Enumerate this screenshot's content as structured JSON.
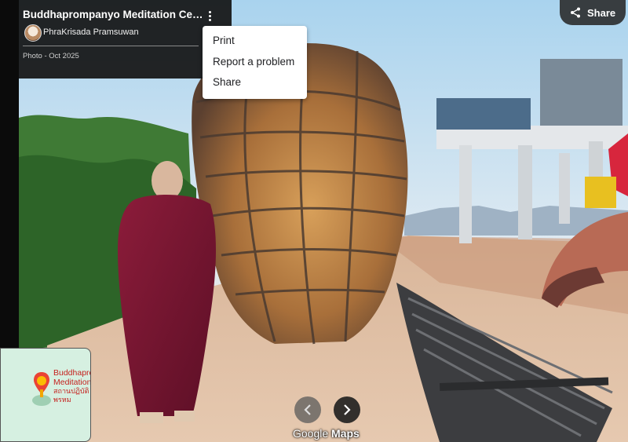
{
  "info_card": {
    "title": "Buddhaprompanyo Meditation Center",
    "author": "PhraKrisada Pramsuwan",
    "photo_date": "Photo - Oct 2025"
  },
  "menu": {
    "items": [
      "Print",
      "Report a problem",
      "Share"
    ]
  },
  "share_button": {
    "label": "Share"
  },
  "navigation": {
    "prev_icon": "chevron-left-icon",
    "next_icon": "chevron-right-icon"
  },
  "watermark": {
    "word1": "Google",
    "word2": "Maps"
  },
  "minimap": {
    "place_label": "Buddhaprompanyo Meditation",
    "place_label_thai": "สถานปฏิบัติ พรหมปัญโญ",
    "pin_icon": "map-pin-icon"
  },
  "colors": {
    "pin": "#ea4335",
    "map_bg": "#d6f0e1",
    "card_bg": "#141414"
  }
}
